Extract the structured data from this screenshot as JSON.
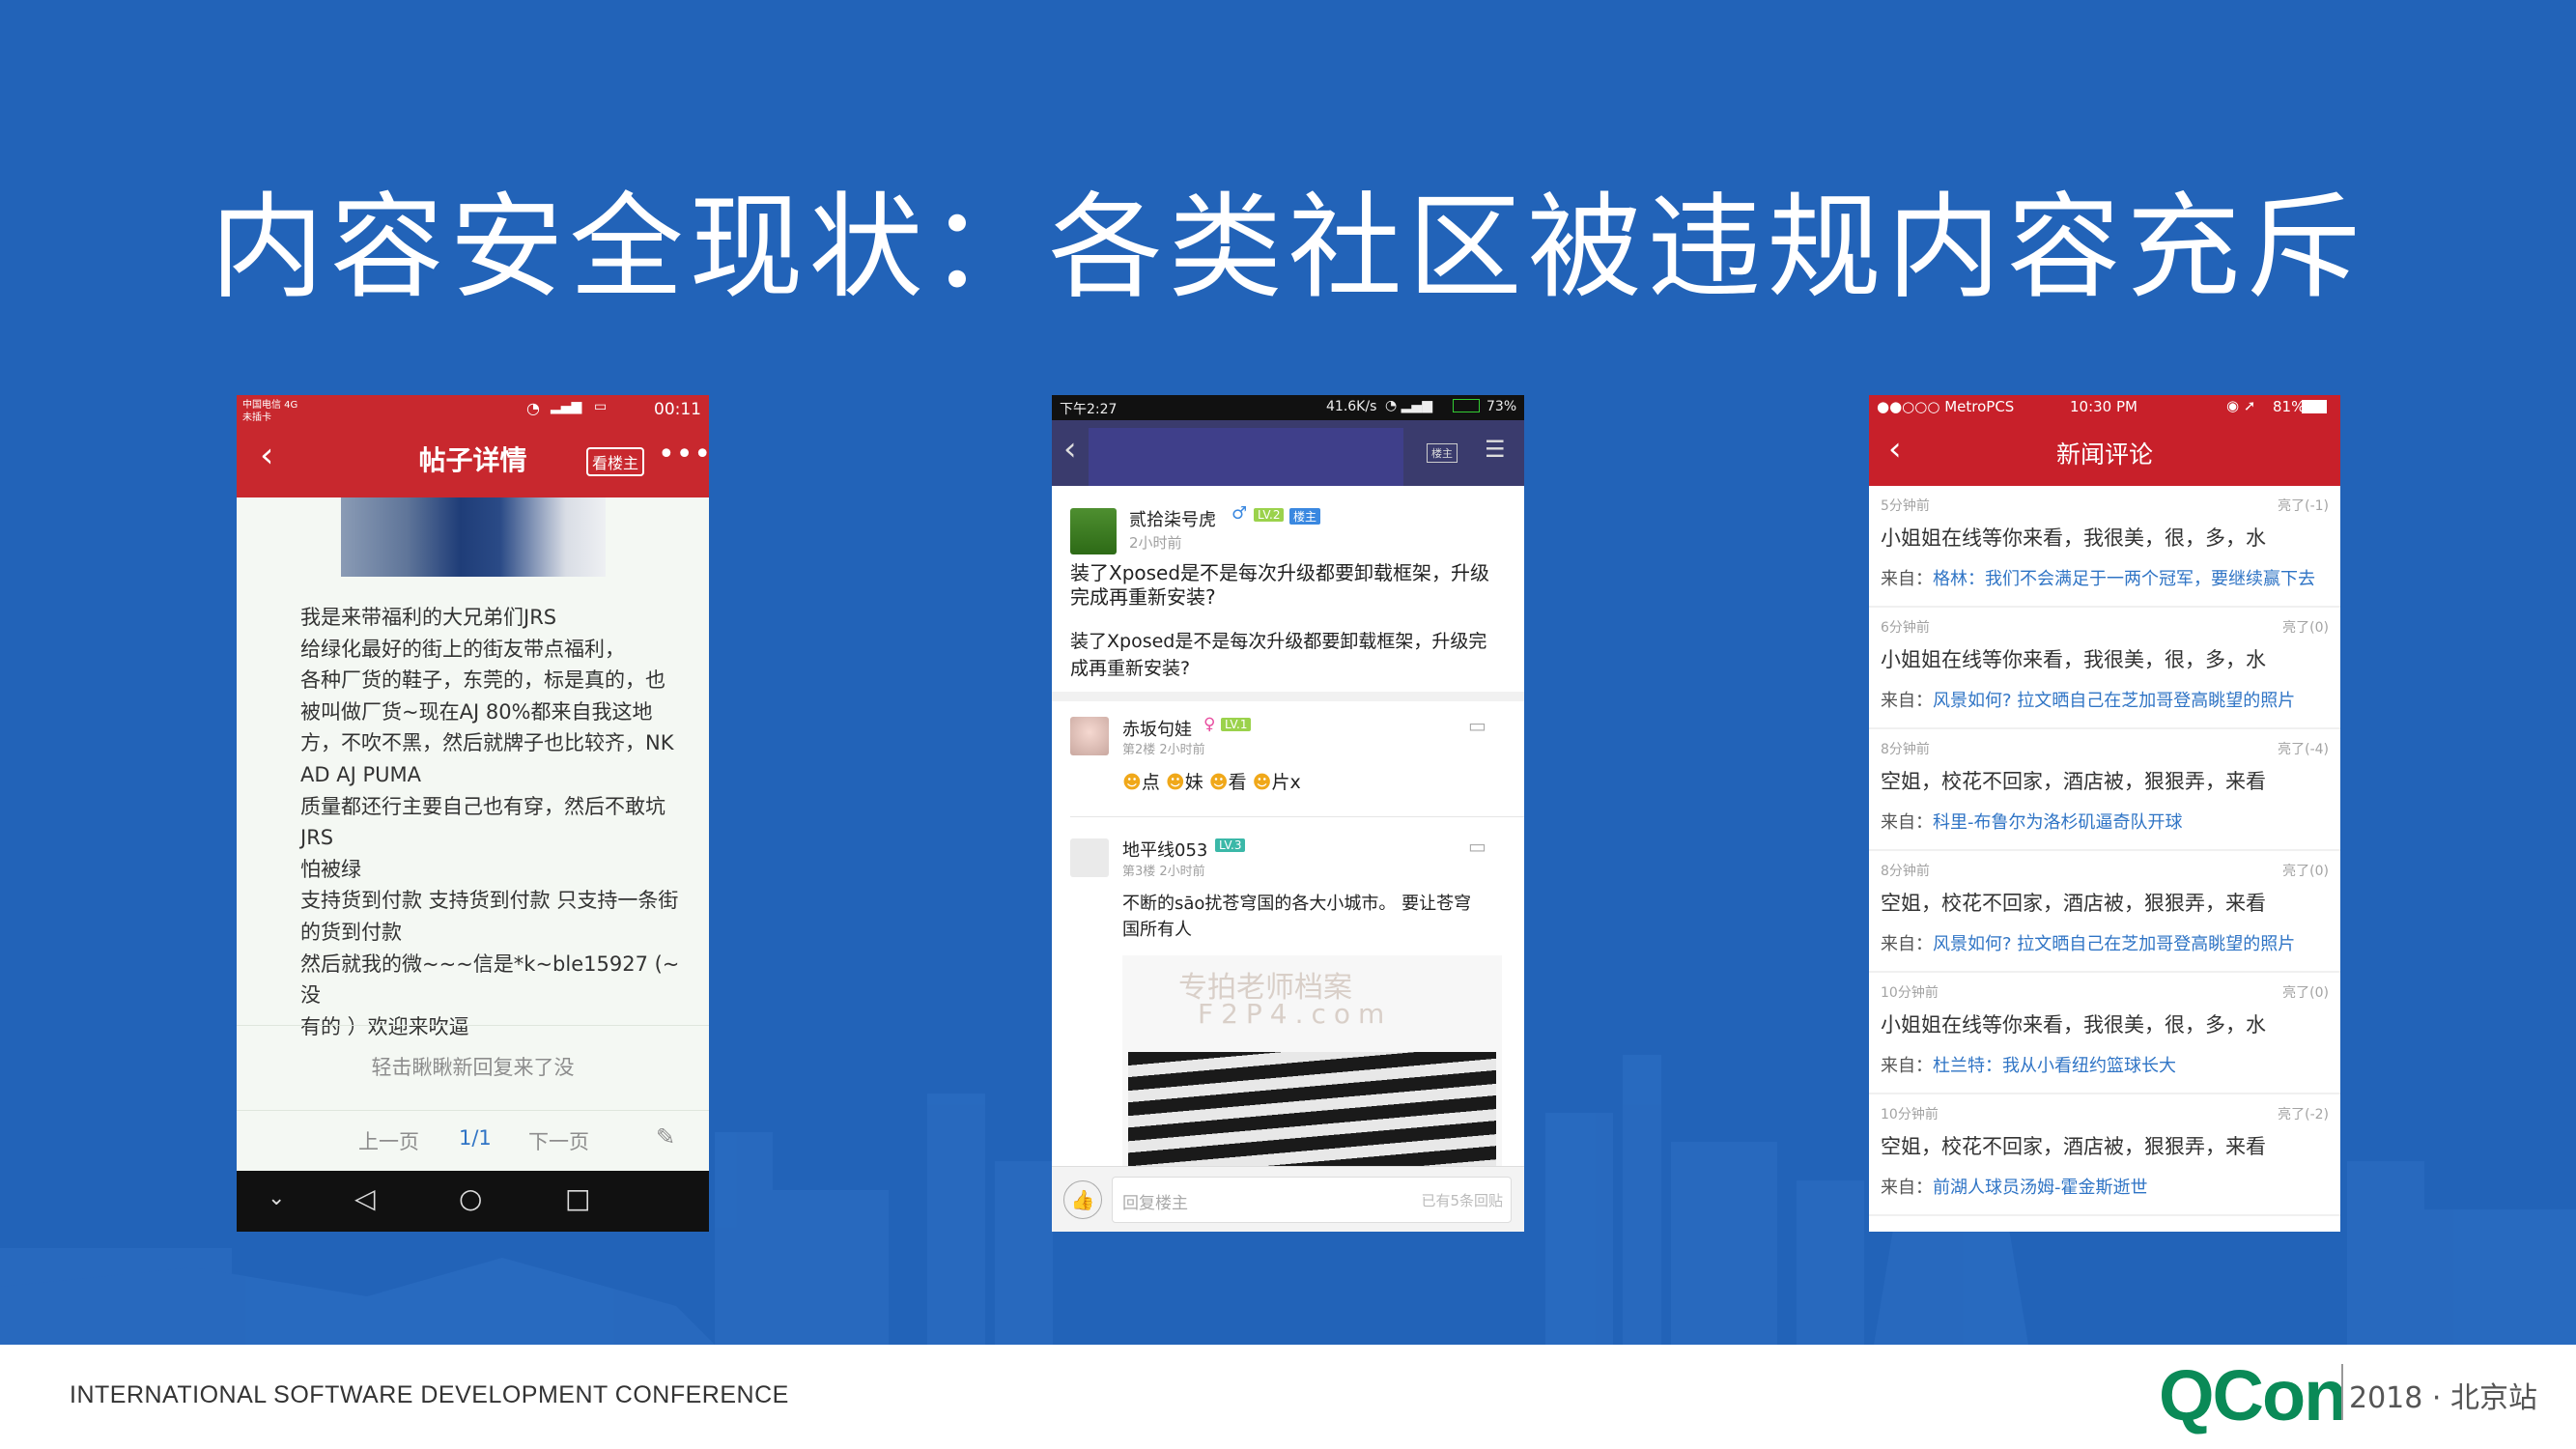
{
  "slide": {
    "title": "内容安全现状：各类社区被违规内容充斥",
    "footer_left": "INTERNATIONAL SOFTWARE DEVELOPMENT CONFERENCE",
    "brand": "QCon",
    "brand_suffix": "2018 · 北京站",
    "colors": {
      "background": "#2263b8",
      "brand_green": "#0a8a57",
      "app_red": "#c8282e"
    }
  },
  "phone1": {
    "status_carrier": "中国电信 4G",
    "status_carrier2": "未插卡",
    "status_time": "00:11",
    "nav_title": "帖子详情",
    "chip_label": "看楼主",
    "post_lines": [
      "我是来带福利的大兄弟们JRS",
      "给绿化最好的街上的街友带点福利，",
      "各种厂货的鞋子，东莞的，标是真的，也",
      "被叫做厂货~现在AJ 80%都来自我这地",
      "方，不吹不黑，然后就牌子也比较齐，NK",
      "AD AJ PUMA",
      "质量都还行主要自己也有穿，然后不敢坑",
      "JRS",
      "怕被绿",
      "支持货到付款 支持货到付款 只支持一条街",
      "的货到付款",
      "然后就我的微~~~信是*k~ble15927 (~没",
      "有的 ）欢迎来吹逼"
    ],
    "refresh_text": "轻击瞅瞅新回复来了没",
    "prev_label": "上一页",
    "page_indicator": "1/1",
    "next_label": "下一页"
  },
  "phone2": {
    "status_time": "下午2:27",
    "status_right": "41.6K/s",
    "battery": "73%",
    "op_badge_nav": "楼主",
    "op": {
      "name": "贰拾柒号虎",
      "level": "LV.2",
      "op_badge": "楼主",
      "time": "2小时前",
      "title": "装了Xposed是不是每次升级都要卸载框架，升级完成再重新安装?",
      "title_line1": "装了Xposed是不是每次升级都要卸载框架，升级",
      "title_line2": "完成再重新安装?",
      "body_line1": "装了Xposed是不是每次升级都要卸载框架，升级完",
      "body_line2": "成再重新安装?"
    },
    "reply1": {
      "name": "赤坂句娃",
      "level": "LV.1",
      "meta": "第2楼  2小时前",
      "text": [
        "点",
        "妹",
        "看",
        "片x"
      ]
    },
    "reply2": {
      "name": "地平线053",
      "level": "LV.3",
      "meta": "第3楼  2小时前",
      "line1": "不断的sāo扰苍穹国的各大小城市。 要让苍穹",
      "line2": "国所有人",
      "watermark1": "专拍老师档案",
      "watermark2": "F2P4.com"
    },
    "reply_placeholder": "回复楼主",
    "reply_count": "已有5条回贴"
  },
  "phone3": {
    "status_carrier": "●●○○○ MetroPCS",
    "status_time": "10:30 PM",
    "battery": "81%",
    "nav_title": "新闻评论",
    "comments": [
      {
        "time": "5分钟前",
        "likes": "亮了(-1)",
        "text": "小姐姐在线等你来看，我很美，很，多，水",
        "source_label": "来自：",
        "source": "格林：我们不会满足于一两个冠军，要继续赢下去"
      },
      {
        "time": "6分钟前",
        "likes": "亮了(0)",
        "text": "小姐姐在线等你来看，我很美，很，多，水",
        "source_label": "来自：",
        "source": "风景如何? 拉文晒自己在芝加哥登高眺望的照片"
      },
      {
        "time": "8分钟前",
        "likes": "亮了(-4)",
        "text": "空姐，校花不回家，酒店被，狠狠弄，来看",
        "source_label": "来自：",
        "source": "科里-布鲁尔为洛杉矶逼奇队开球"
      },
      {
        "time": "8分钟前",
        "likes": "亮了(0)",
        "text": "空姐，校花不回家，酒店被，狠狠弄，来看",
        "source_label": "来自：",
        "source": "风景如何? 拉文晒自己在芝加哥登高眺望的照片"
      },
      {
        "time": "10分钟前",
        "likes": "亮了(0)",
        "text": "小姐姐在线等你来看，我很美，很，多，水",
        "source_label": "来自：",
        "source": "杜兰特：我从小看纽约篮球长大"
      },
      {
        "time": "10分钟前",
        "likes": "亮了(-2)",
        "text": "空姐，校花不回家，酒店被，狠狠弄，来看",
        "source_label": "来自：",
        "source": "前湖人球员汤姆-霍金斯逝世"
      }
    ]
  }
}
